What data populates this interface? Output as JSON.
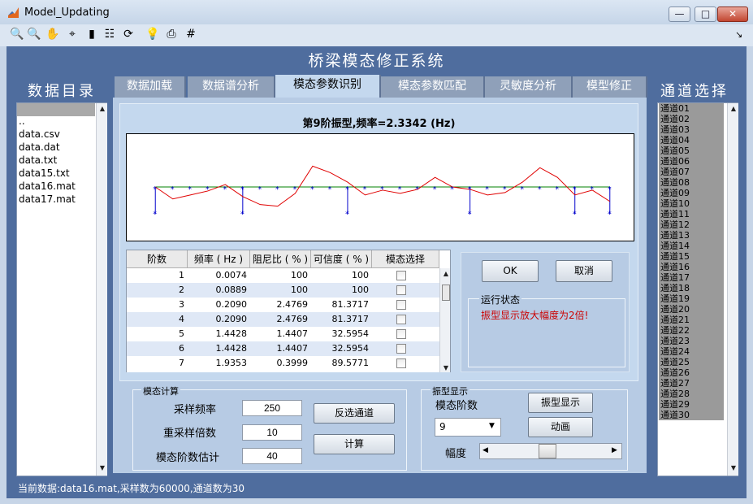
{
  "window": {
    "title": "Model_Updating",
    "minimize_glyph": "—",
    "maximize_glyph": "□",
    "close_glyph": "✕"
  },
  "toolbar": [
    {
      "name": "zoom-in-icon",
      "glyph": "🔍"
    },
    {
      "name": "zoom-out-icon",
      "glyph": "🔍"
    },
    {
      "name": "pan-hand-icon",
      "glyph": "✋"
    },
    {
      "name": "data-cursor-icon",
      "glyph": "⌖"
    },
    {
      "name": "colorbar-icon",
      "glyph": "▮"
    },
    {
      "name": "legend-icon",
      "glyph": "☷"
    },
    {
      "name": "rotate-3d-icon",
      "glyph": "⟳"
    },
    {
      "name": "lightbulb-icon",
      "glyph": "💡"
    },
    {
      "name": "print-icon",
      "glyph": "⎙"
    },
    {
      "name": "grid-icon",
      "glyph": "#"
    }
  ],
  "toolbar_overflow": "↘",
  "app": {
    "title": "桥梁模态修正系统",
    "left_heading": "数据目录",
    "right_heading": "通道选择"
  },
  "files": [
    "..",
    "data.csv",
    "data.dat",
    "data.txt",
    "data15.txt",
    "data16.mat",
    "data17.mat"
  ],
  "tabs": [
    "数据加载",
    "数据谱分析",
    "模态参数识别",
    "模态参数匹配",
    "灵敏度分析",
    "模型修正"
  ],
  "active_tab": 2,
  "plot": {
    "title": "第9阶振型,频率=2.3342 (Hz)"
  },
  "table": {
    "headers": [
      "阶数",
      "频率 ( Hz )",
      "阻尼比 ( % )",
      "可信度 ( % )",
      "模态选择"
    ],
    "rows": [
      {
        "order": "1",
        "freq": "0.0074",
        "damp": "100",
        "conf": "100"
      },
      {
        "order": "2",
        "freq": "0.0889",
        "damp": "100",
        "conf": "100"
      },
      {
        "order": "3",
        "freq": "0.2090",
        "damp": "2.4769",
        "conf": "81.3717"
      },
      {
        "order": "4",
        "freq": "0.2090",
        "damp": "2.4769",
        "conf": "81.3717"
      },
      {
        "order": "5",
        "freq": "1.4428",
        "damp": "1.4407",
        "conf": "32.5954"
      },
      {
        "order": "6",
        "freq": "1.4428",
        "damp": "1.4407",
        "conf": "32.5954"
      },
      {
        "order": "7",
        "freq": "1.9353",
        "damp": "0.3999",
        "conf": "89.5771"
      }
    ]
  },
  "actions": {
    "ok": "OK",
    "cancel": "取消",
    "status_title": "运行状态",
    "status_msg": "振型显示放大幅度为2倍!"
  },
  "modal_calc": {
    "title": "模态计算",
    "sample_rate_label": "采样频率",
    "sample_rate": "250",
    "resample_label": "重采样倍数",
    "resample": "10",
    "order_est_label": "模态阶数估计",
    "order_est": "40",
    "invert_btn": "反选通道",
    "compute_btn": "计算"
  },
  "mode_display": {
    "title": "振型显示",
    "order_label": "模态阶数",
    "order_value": "9",
    "show_btn": "振型显示",
    "animate_btn": "动画",
    "amp_label": "幅度",
    "amplitude": 0.5
  },
  "channels": [
    "通道01",
    "通道02",
    "通道03",
    "通道04",
    "通道05",
    "通道06",
    "通道07",
    "通道08",
    "通道09",
    "通道10",
    "通道11",
    "通道12",
    "通道13",
    "通道14",
    "通道15",
    "通道16",
    "通道17",
    "通道18",
    "通道19",
    "通道20",
    "通道21",
    "通道22",
    "通道23",
    "通道24",
    "通道25",
    "通道26",
    "通道27",
    "通道28",
    "通道29",
    "通道30"
  ],
  "status": "当前数据:data16.mat,采样数为60000,通道数为30",
  "colors": {
    "background": "#4f6d9e",
    "panel": "#b7cbe4",
    "status_text": "#cc0000",
    "mode_line": "#e00000",
    "beam_line": "#008000",
    "nodes": "#0000cc"
  }
}
